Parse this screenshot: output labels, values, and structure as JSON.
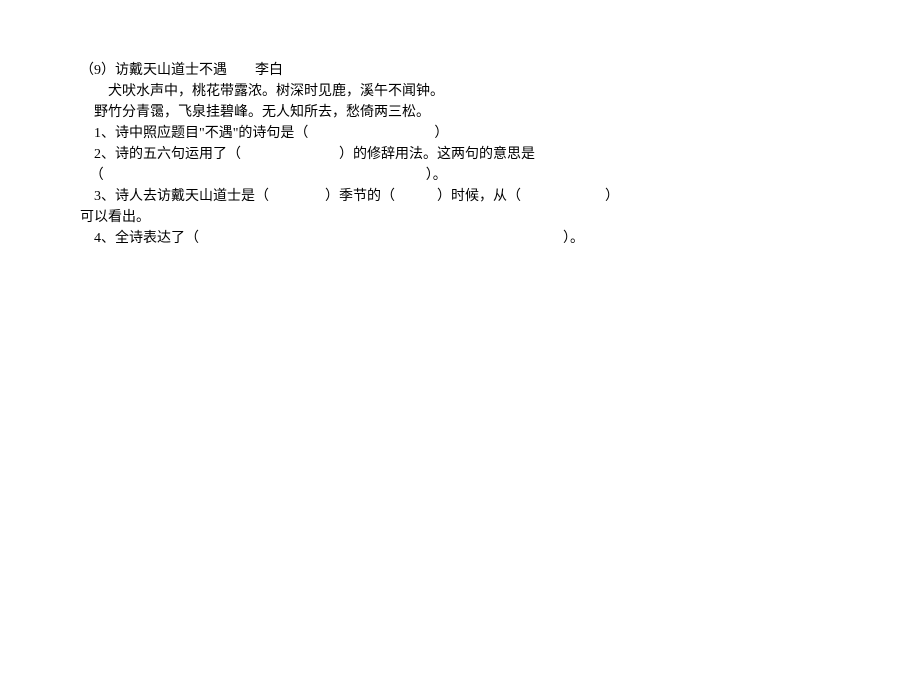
{
  "doc": {
    "line1": "（9）访戴天山道士不遇　　李白",
    "line2": "犬吠水声中，桃花带露浓。树深时见鹿，溪午不闻钟。",
    "line3": "野竹分青霭，飞泉挂碧峰。无人知所去，愁倚两三松。",
    "line4": "1、诗中照应题目\"不遇\"的诗句是（　　　　　　　　　）",
    "line5": "2、诗的五六句运用了（　　　　　　　）的修辞用法。这两句的意思是",
    "line6": "（　　　　　　　　　　　　　　　　　　　　　　　）。",
    "line7": "3、诗人去访戴天山道士是（　　　　）季节的（　　　）时候，从（　　　　　　）",
    "line8": "可以看出。",
    "line9": "4、全诗表达了（　　　　　　　　　　　　　　　　　　　　　　　　　　）。"
  }
}
